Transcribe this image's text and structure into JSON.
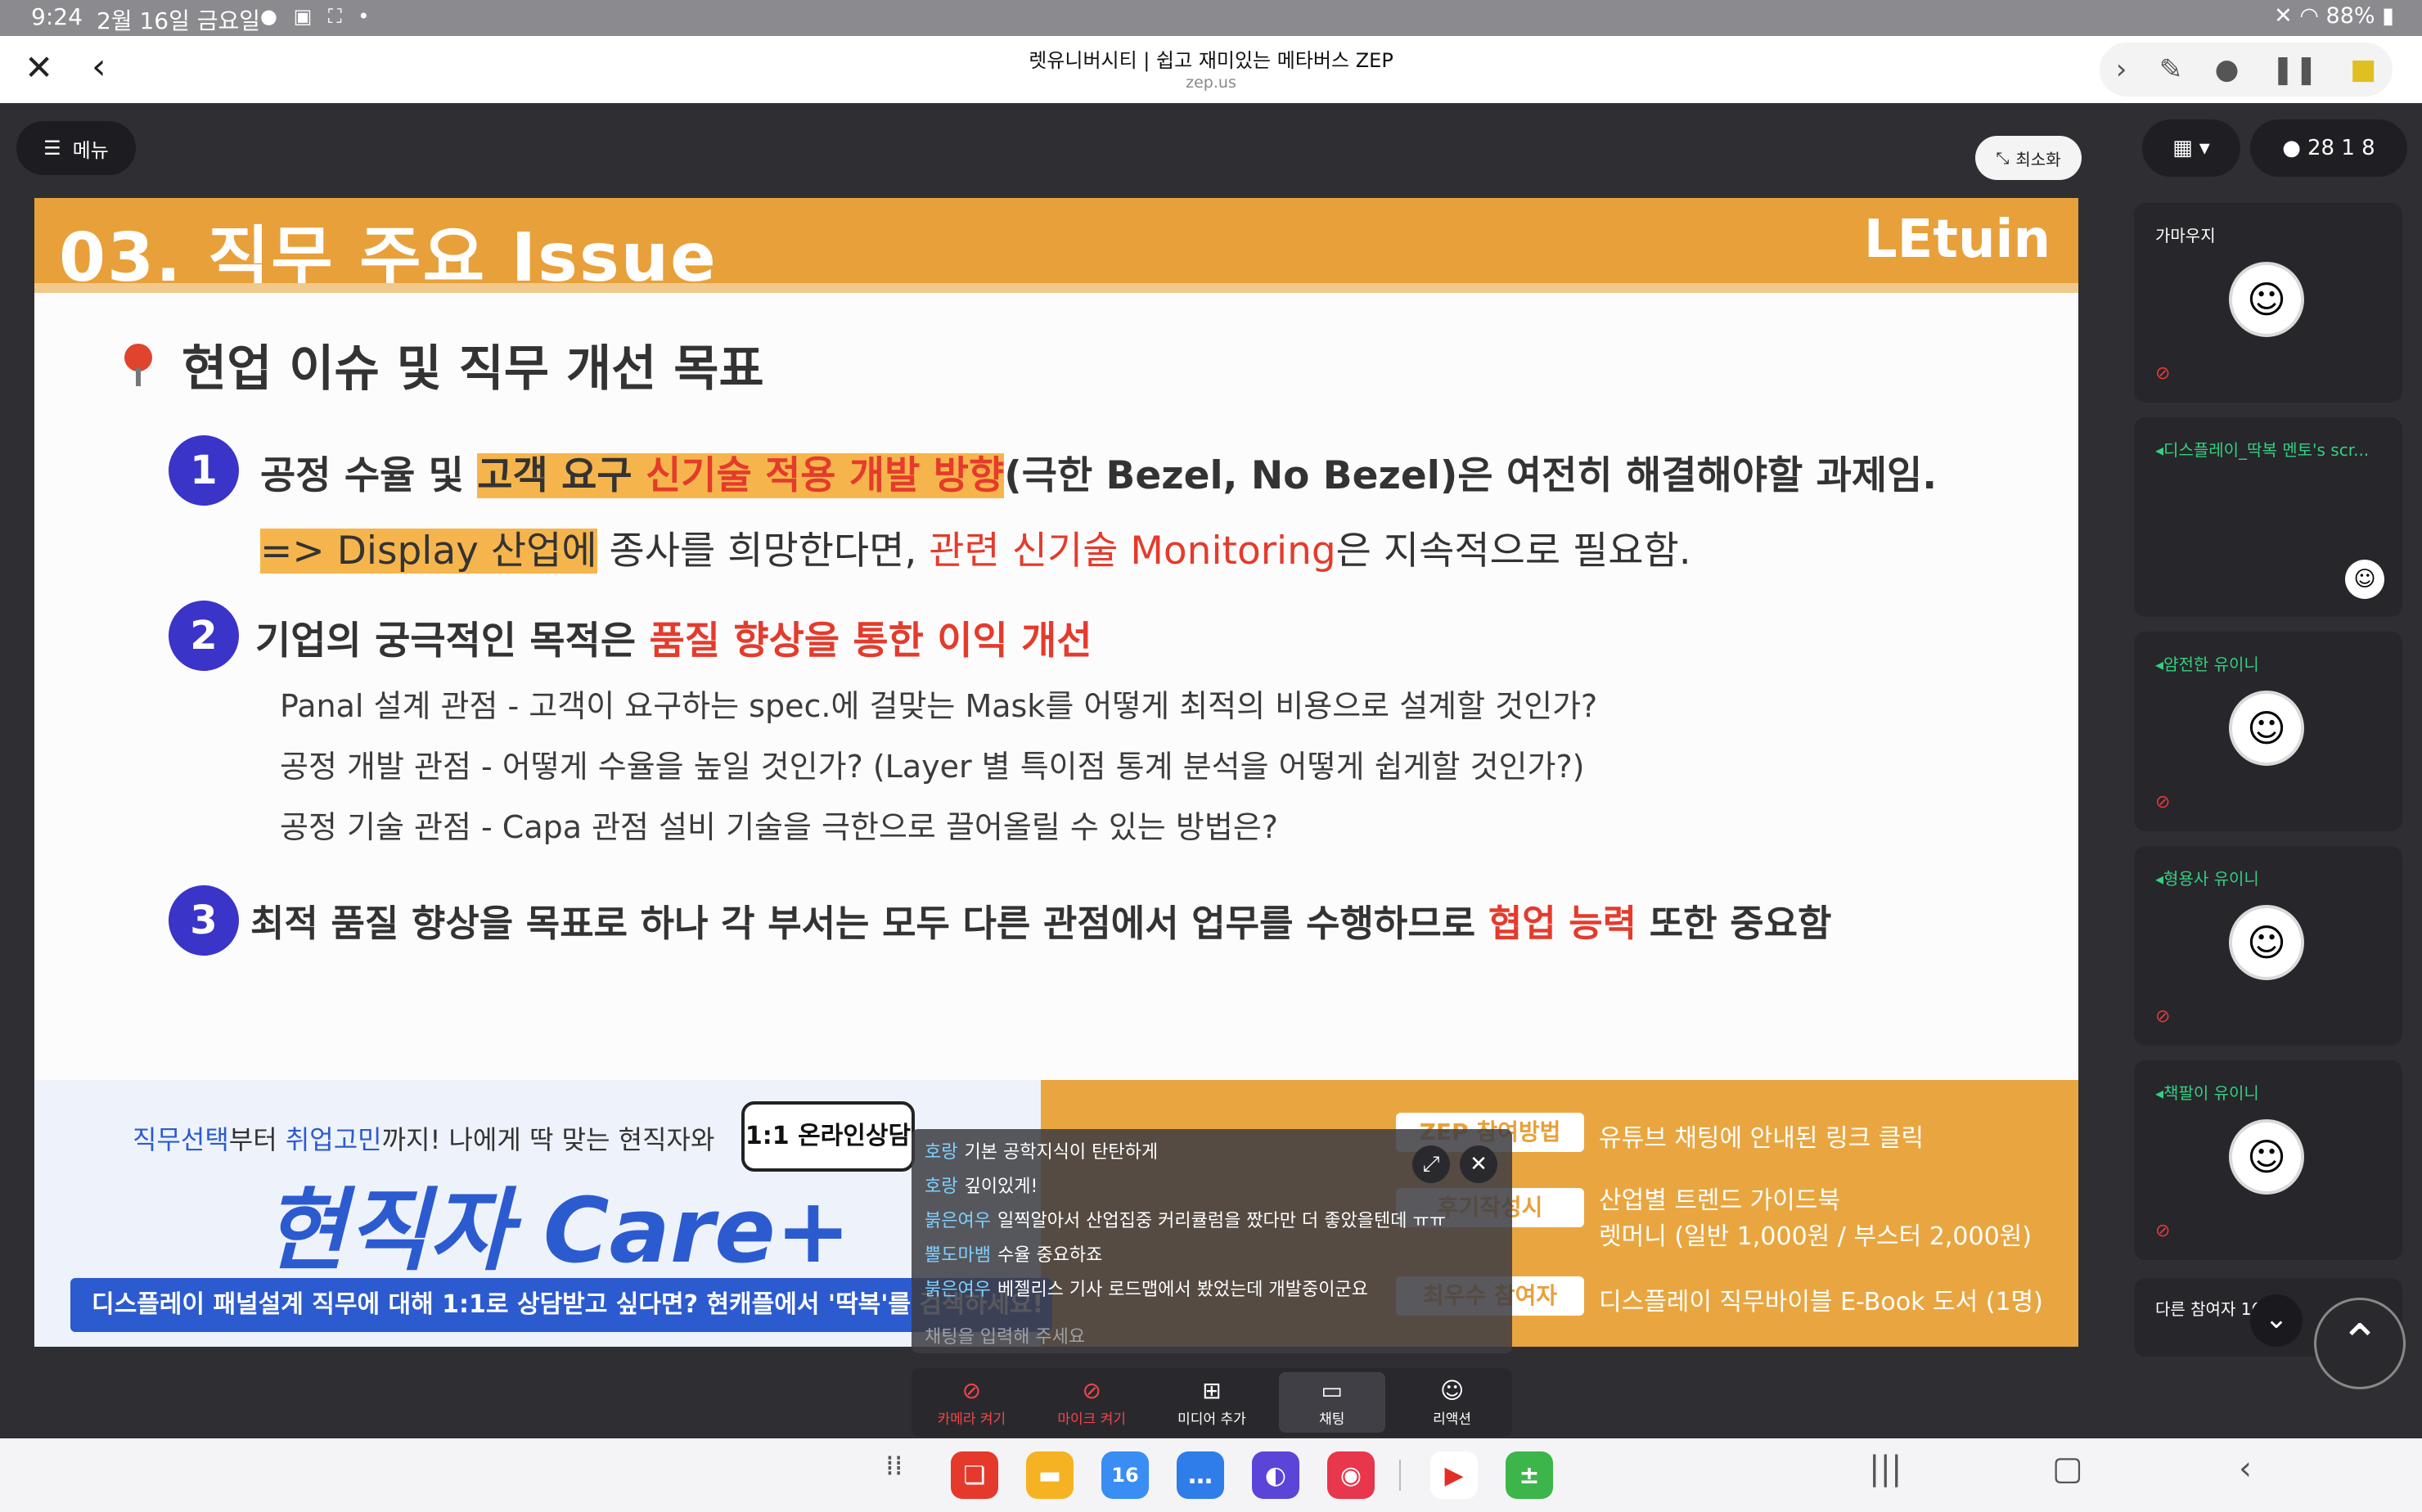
{
  "status_bar": {
    "time": "9:24",
    "date": "2월 16일 금요일",
    "battery": "88%"
  },
  "browser": {
    "title": "렛유니버시티 | 쉽고 재미있는 메타버스 ZEP",
    "url": "zep.us"
  },
  "toolbar": {
    "menu_label": "메뉴",
    "minimize_label": "최소화"
  },
  "slide": {
    "title": "03. 직무 주요 Issue",
    "brand": "LEtuin",
    "section_title": "현업 이슈 및 직무 개선 목표",
    "item1": {
      "number": "1",
      "a": "공정 수율 및 ",
      "b": "고객 요구 ",
      "c": "신기술 적용 개발 방향",
      "d": "(극한 Bezel, No Bezel)은 여전히 해결해야할 과제임.",
      "e": "=> Display 산업에",
      "f": " 종사를 희망한다면, ",
      "g": "관련 신기술 Monitoring",
      "h": "은 지속적으로 필요함."
    },
    "item2": {
      "number": "2",
      "a": "기업의 궁극적인 목적은 ",
      "b": "품질 향상을 통한 이익 개선",
      "sub1": "Panal 설계 관점 - 고객이 요구하는 spec.에 걸맞는 Mask를 어떻게 최적의 비용으로 설계할 것인가?",
      "sub2": "공정 개발 관점 - 어떻게 수율을 높일 것인가? (Layer 별 특이점 통계 분석을 어떻게 쉽게할 것인가?)",
      "sub3": "공정 기술 관점 - Capa 관점 설비 기술을 극한으로 끌어올릴 수 있는 방법은?"
    },
    "item3": {
      "number": "3",
      "a": "최적 품질 향상을 목표로 하나 각 부서는 모두 다른 관점에서 업무를 수행하므로 ",
      "b": "협업 능력",
      "c": " 또한 중요함"
    },
    "banner": {
      "line1_a": "직무선택",
      "line1_b": "부터 ",
      "line1_c": "취업고민",
      "line1_d": "까지! 나에게 딱 맞는 현직자와",
      "badge": "1:1 온라인상담",
      "big": "현직자 Care+",
      "bar": "디스플레이 패널설계 직무에 대해 1:1로 상담받고 싶다면? 현캐플에서 '딱복'를 검색하세요!",
      "r_tag1": "ZEP 참여방법",
      "r_text1": "유튜브 채팅에 안내된 링크 클릭",
      "r_tag2": "후기작성시",
      "r_text2a": "산업별 트렌드 가이드북",
      "r_text2b": "렛머니 (일반 1,000원 / 부스터 2,000원)",
      "r_tag3": "최우수 참여자",
      "r_text3": "디스플레이 직무바이블 E-Book 도서 (1명)"
    }
  },
  "chat": {
    "messages": [
      {
        "nick": "호랑",
        "text": "기본 공학지식이 탄탄하게"
      },
      {
        "nick": "호랑",
        "text": "깊이있게!"
      },
      {
        "nick": "붉은여우",
        "text": "일찍알아서 산업집중 커리큘럼을 짰다만 더 좋았을텐데 ㅠㅠ"
      },
      {
        "nick": "뿔도마뱀",
        "text": "수율 중요하죠"
      },
      {
        "nick": "붉은여우",
        "text": "베젤리스 기사 로드맵에서 봤었는데 개발중이군요"
      }
    ],
    "placeholder": "채팅을 입력해 주세요"
  },
  "controls": {
    "camera": "카메라 켜기",
    "mic": "마이크 켜기",
    "media": "미디어 추가",
    "chat": "채팅",
    "reaction": "리액션"
  },
  "right_panel": {
    "participant_count": "28 1 8",
    "participants": [
      {
        "name": "가마우지",
        "talking": false
      },
      {
        "name": "디스플레이_딱복 멘토's scr...",
        "talking": true
      },
      {
        "name": "얌전한 유이니",
        "talking": true
      },
      {
        "name": "형용사 유이니",
        "talking": true
      },
      {
        "name": "책팔이 유이니",
        "talking": true
      }
    ],
    "others_label": "다른 참여자 16명"
  },
  "navbar": {
    "calendar_day": "16"
  },
  "colors": {
    "accent_orange": "#e8a03a",
    "accent_blue": "#2c5bd0",
    "accent_red": "#e43b2c",
    "num_purple": "#3a34c8"
  }
}
